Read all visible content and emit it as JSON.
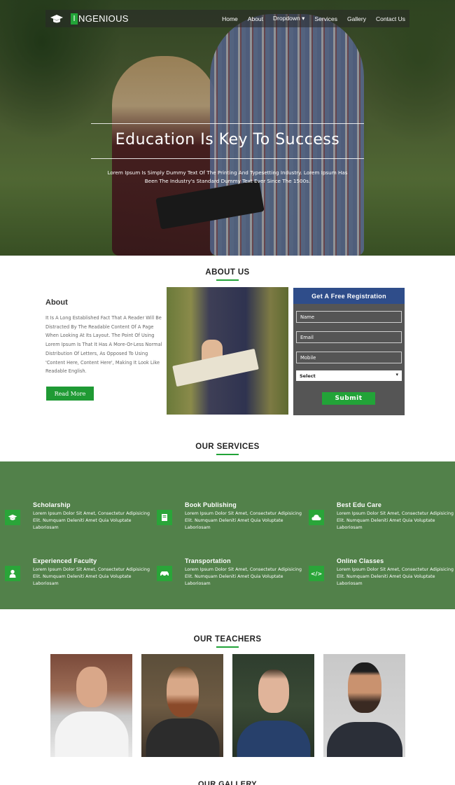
{
  "brand": {
    "name": "NGENIOUS",
    "mark": "I"
  },
  "nav": [
    "Home",
    "About",
    "Dropdown",
    "Services",
    "Gallery",
    "Contact Us"
  ],
  "hero": {
    "title": "Education Is Key To Success",
    "text": "Lorem Ipsum Is Simply Dummy Text Of The Printing And Typesetting Industry. Lorem Ipsum Has Been The Industry's Standard Dummy Text Ever Since The 1500s."
  },
  "about": {
    "section_title": "ABOUT US",
    "heading": "About",
    "text": "It Is A Long Established Fact That A Reader Will Be Distracted By The Readable Content Of A Page When Looking At Its Layout. The Point Of Using Lorem Ipsum Is That It Has A More-Or-Less Normal Distribution Of Letters, As Opposed To Using 'Content Here, Content Here', Making It Look Like Readable English.",
    "button": "Read More"
  },
  "registration": {
    "title": "Get A Free Registration",
    "name_placeholder": "Name",
    "email_placeholder": "Email",
    "mobile_placeholder": "Mobile",
    "select_value": "Select",
    "submit": "Submit"
  },
  "services": {
    "section_title": "OUR SERVICES",
    "items": [
      {
        "title": "Scholarship",
        "text": "Lorem Ipsum Dolor Sit Amet, Consectetur Adipisicing Elit. Numquam Deleniti Amet Quia Voluptate Laboriosam",
        "icon": "graduation-cap-icon",
        "glyph": "🎓"
      },
      {
        "title": "Book Publishing",
        "text": "Lorem Ipsum Dolor Sit Amet, Consectetur Adipisicing Elit. Numquam Deleniti Amet Quia Voluptate Laboriosam",
        "icon": "book-icon",
        "glyph": "📘"
      },
      {
        "title": "Best Edu Care",
        "text": "Lorem Ipsum Dolor Sit Amet, Consectetur Adipisicing Elit. Numquam Deleniti Amet Quia Voluptate Laboriosam",
        "icon": "cloud-icon",
        "glyph": "☁"
      },
      {
        "title": "Experienced Faculty",
        "text": "Lorem Ipsum Dolor Sit Amet, Consectetur Adipisicing Elit. Numquam Deleniti Amet Quia Voluptate Laboriosam",
        "icon": "user-icon",
        "glyph": "👤"
      },
      {
        "title": "Transportation",
        "text": "Lorem Ipsum Dolor Sit Amet, Consectetur Adipisicing Elit. Numquam Deleniti Amet Quia Voluptate Laboriosam",
        "icon": "car-icon",
        "glyph": "🚗"
      },
      {
        "title": "Online Classes",
        "text": "Lorem Ipsum Dolor Sit Amet, Consectetur Adipisicing Elit. Numquam Deleniti Amet Quia Voluptate Laboriosam",
        "icon": "code-icon",
        "glyph": "</>"
      }
    ]
  },
  "teachers": {
    "section_title": "OUR TEACHERS"
  },
  "gallery": {
    "section_title": "OUR GALLERY"
  },
  "colors": {
    "accent": "#22a338",
    "services_bg": "#52814a",
    "registration_header": "#2f4d8a"
  }
}
